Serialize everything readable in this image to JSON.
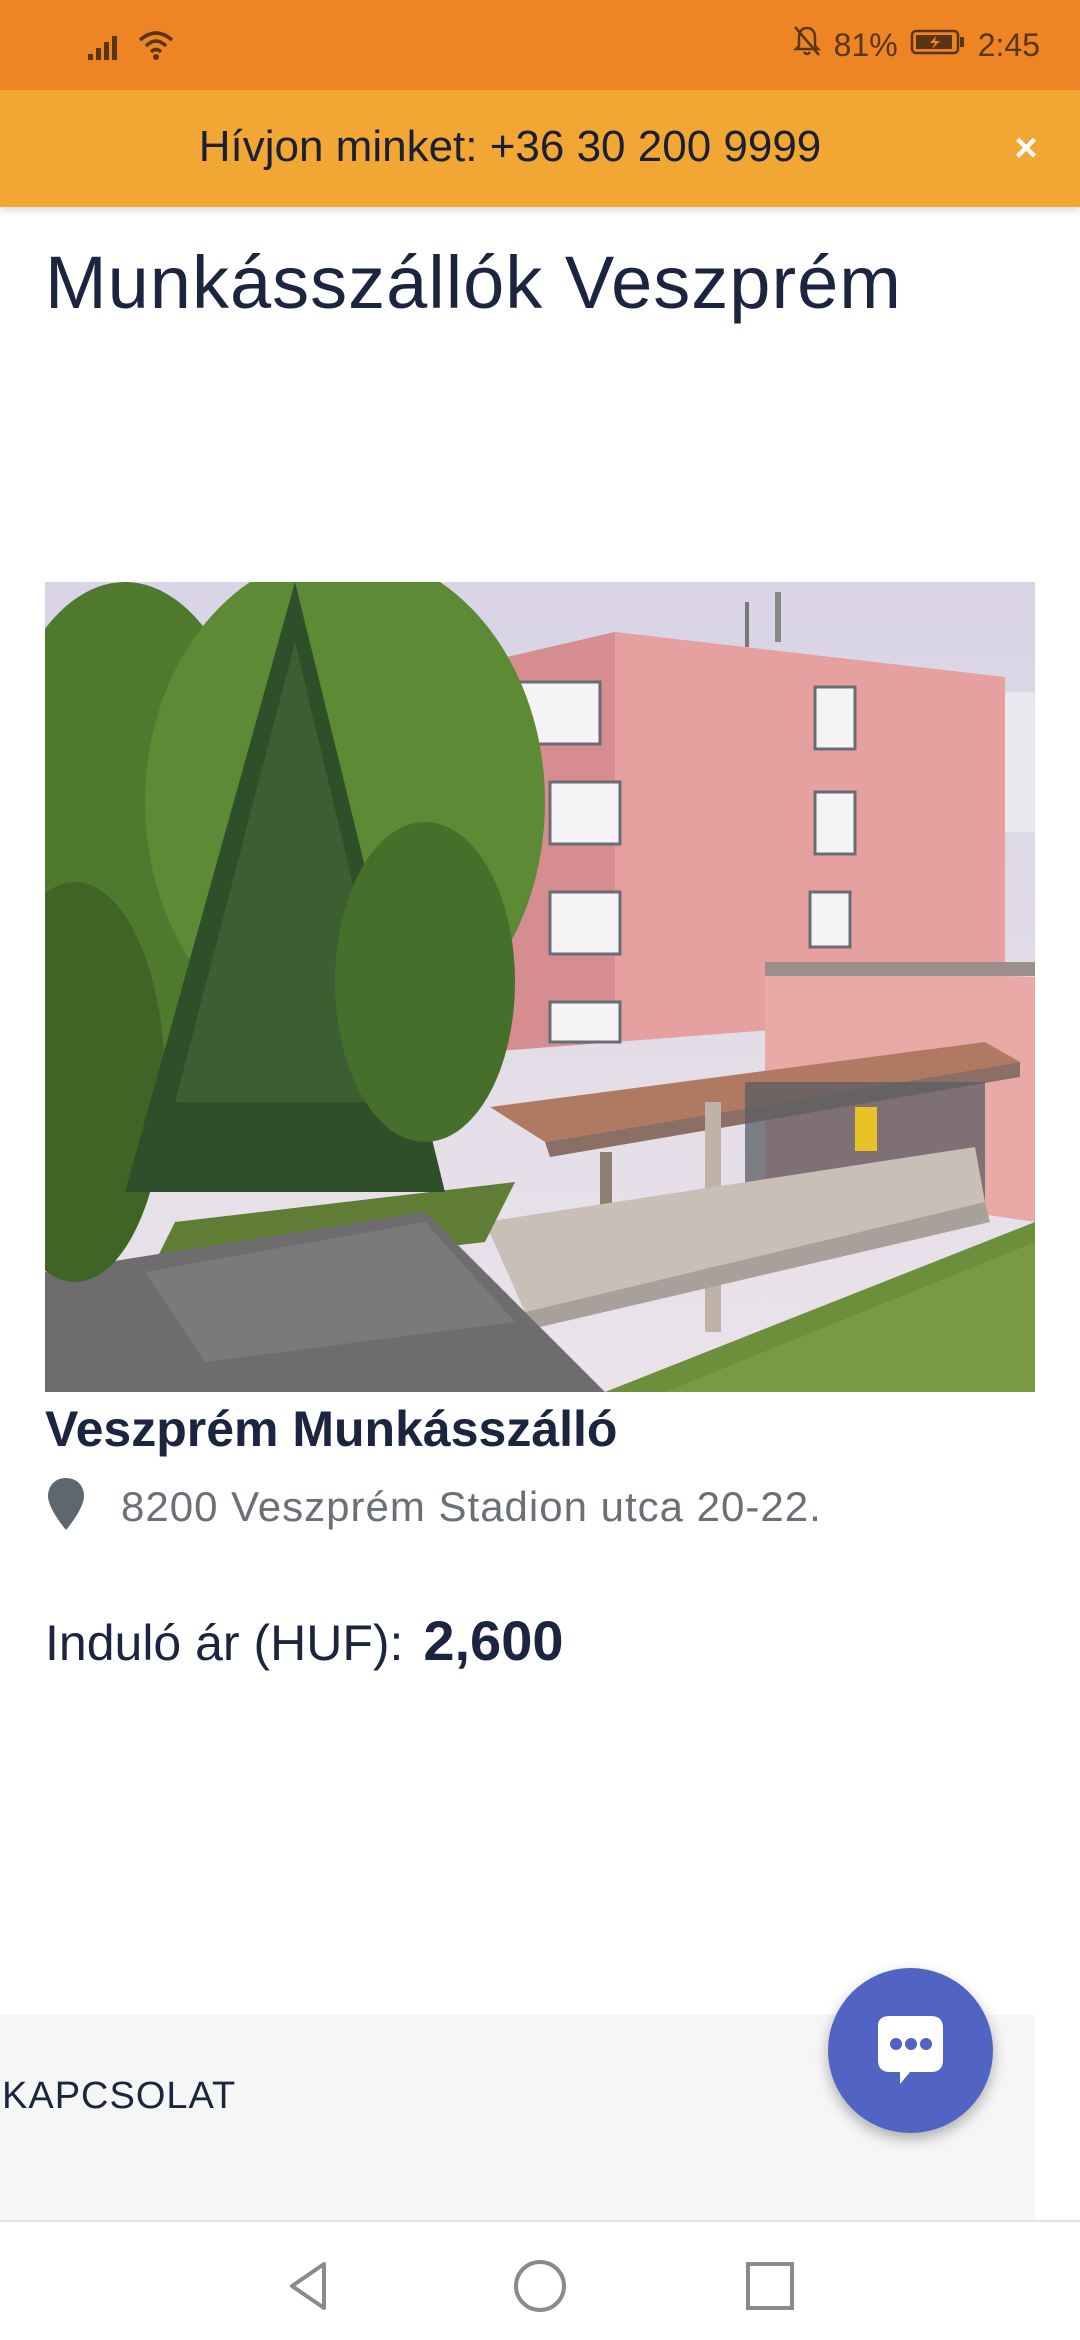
{
  "status_bar": {
    "battery": "81%",
    "time": "2:45",
    "icons": [
      "signal-icon",
      "wifi-icon",
      "bell-off-icon",
      "battery-icon"
    ]
  },
  "banner": {
    "text": "Hívjon minket: +36 30 200 9999",
    "close_label": "×"
  },
  "page": {
    "title": "Munkásszállók Veszprém"
  },
  "listing": {
    "name": "Veszprém Munkásszálló",
    "address": "8200 Veszprém Stadion utca 20-22.",
    "price_label": "Induló ár (HUF):",
    "price_value": "2,600"
  },
  "footer": {
    "contact_title": "KAPCSOLAT"
  },
  "nav": [
    "back-icon",
    "home-icon",
    "recents-icon"
  ],
  "colors": {
    "status_bar": "#ee8524",
    "banner": "#f2a734",
    "title_text": "#1b2540",
    "chat_fab": "#5164c4"
  }
}
